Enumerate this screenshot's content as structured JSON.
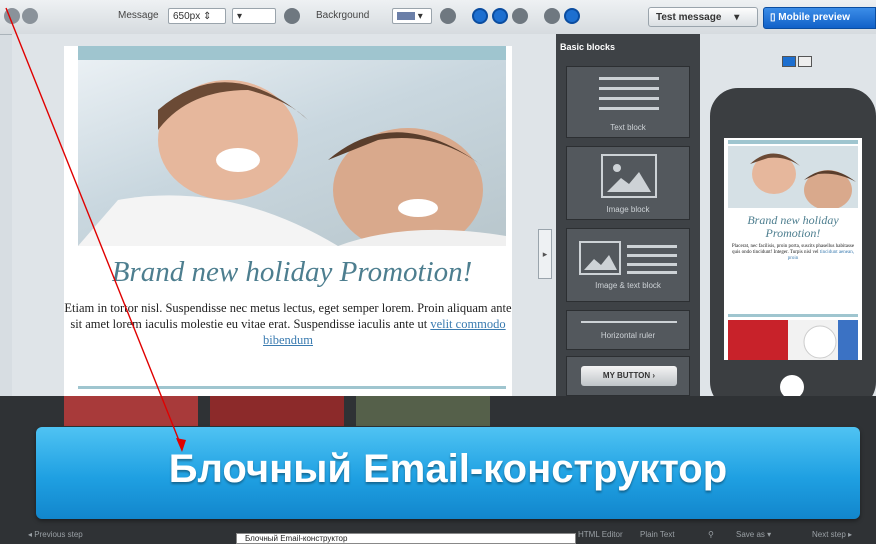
{
  "toolbar": {
    "message_label": "Message",
    "width_value": "650px",
    "background_label": "Backrgound",
    "test_message_label": "Test message",
    "mobile_preview_label": "Mobile preview"
  },
  "email": {
    "headline": "Brand new holiday Promotion!",
    "body": "Etiam in tortor nisl. Suspendisse nec metus lectus, eget semper lorem. Proin aliquam ante sit amet lorem iaculis molestie eu vitae erat. Suspendisse iaculis ante ut",
    "link": "velit commodo bibendum"
  },
  "panel": {
    "title": "Basic blocks",
    "blocks": [
      {
        "label": "Text block"
      },
      {
        "label": "Image block"
      },
      {
        "label": "Image & text block"
      },
      {
        "label": "Horizontal ruler"
      }
    ],
    "button_label": "MY BUTTON ›"
  },
  "mobile": {
    "headline": "Brand new holiday Promotion!",
    "body": "Placerat, nec facilisis, proin porta, suscits phasellus habitasse quis ondo tincidunt! Integer. Turpis nisl vel",
    "link": "tincidunt aenean, proin"
  },
  "banner": {
    "title": "Блочный Email-конструктор"
  },
  "footer": {
    "previous_step": "Previous step",
    "html_editor": "HTML Editor",
    "plain_text": "Plain Text",
    "save_as": "Save as",
    "next_step": "Next step",
    "tooltip_text": "Блочный Email-конструктор"
  },
  "colors": {
    "accent_blue": "#1d6fd0",
    "banner_blue": "#1fa0e2",
    "headline_teal": "#4d7e8f",
    "arrow_red": "#e00000"
  }
}
